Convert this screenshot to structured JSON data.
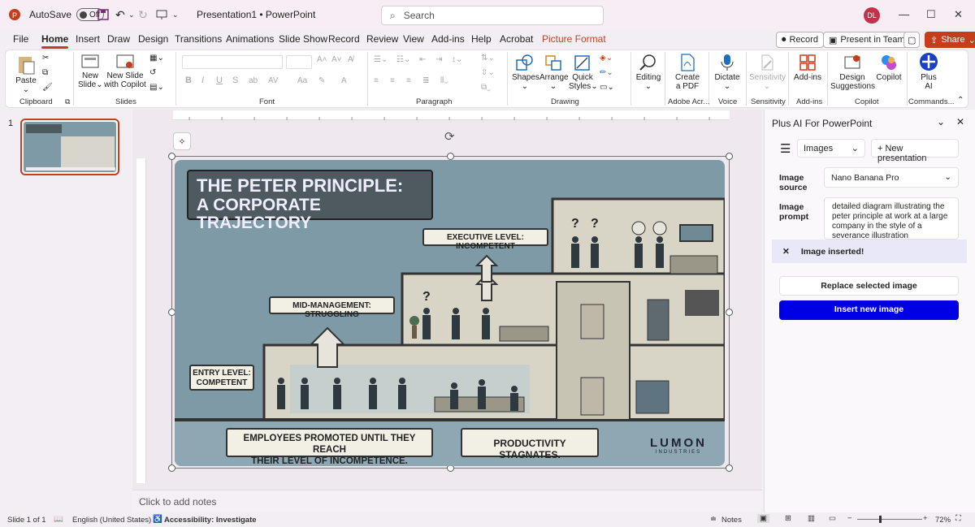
{
  "titlebar": {
    "autosave_label": "AutoSave",
    "autosave_state": "Off",
    "doc_title": "Presentation1  •  PowerPoint",
    "search_placeholder": "Search",
    "user_initials": "DL"
  },
  "menu": {
    "items": [
      "File",
      "Home",
      "Insert",
      "Draw",
      "Design",
      "Transitions",
      "Animations",
      "Slide Show",
      "Record",
      "Review",
      "View",
      "Add-ins",
      "Help",
      "Acrobat",
      "Picture Format"
    ],
    "active": "Home",
    "record_btn": "Record",
    "teams_btn": "Present in Teams",
    "share_btn": "Share"
  },
  "ribbon": {
    "paste": "Paste",
    "new_slide": [
      "New",
      "Slide"
    ],
    "new_slide_copilot": [
      "New Slide",
      "with Copilot"
    ],
    "shapes": "Shapes",
    "arrange": "Arrange",
    "quick_styles": [
      "Quick",
      "Styles"
    ],
    "editing": "Editing",
    "create_pdf": [
      "Create",
      "a PDF"
    ],
    "dictate": "Dictate",
    "sensitivity": "Sensitivity",
    "addins": "Add-ins",
    "design_suggestions": [
      "Design",
      "Suggestions"
    ],
    "copilot": "Copilot",
    "plus_ai": [
      "Plus",
      "AI"
    ],
    "groups": [
      "Clipboard",
      "Slides",
      "Font",
      "Paragraph",
      "Drawing",
      "Adobe Acr...",
      "Voice",
      "Sensitivity",
      "Add-ins",
      "Copilot",
      "Commands..."
    ]
  },
  "thumbs": {
    "slide_number": "1"
  },
  "slide": {
    "title_line1": "THE PETER PRINCIPLE:",
    "title_line2": "A CORPORATE TRAJECTORY",
    "exec_label": "EXECUTIVE LEVEL: INCOMPETENT",
    "mid_label": "MID-MANAGEMENT: STRUGGLING",
    "entry_label_1": "ENTRY LEVEL:",
    "entry_label_2": "COMPETENT",
    "bottom_1a": "EMPLOYEES PROMOTED UNTIL THEY REACH",
    "bottom_1b": "THEIR LEVEL OF INCOMPETENCE.",
    "bottom_2": "PRODUCTIVITY STAGNATES.",
    "logo": "LUMON",
    "logo_sub": "INDUSTRIES",
    "question": "?"
  },
  "notes": {
    "placeholder": "Click to add notes"
  },
  "pane": {
    "title": "Plus AI For PowerPoint",
    "mode_select": "Images",
    "new_presentation": "New presentation",
    "source_label": [
      "Image",
      "source"
    ],
    "source_value": "Nano Banana Pro",
    "prompt_label": [
      "Image",
      "prompt"
    ],
    "prompt_value": "detailed diagram illustrating the peter principle at work at a large company in the style of a severance illustration",
    "toast": "Image inserted!",
    "replace_btn": "Replace selected image",
    "insert_btn": "Insert new image",
    "accent": "#0000e6"
  },
  "status": {
    "slide": "Slide 1 of 1",
    "language": "English (United States)",
    "accessibility": "Accessibility: Investigate",
    "notes": "Notes",
    "zoom": "72%"
  }
}
